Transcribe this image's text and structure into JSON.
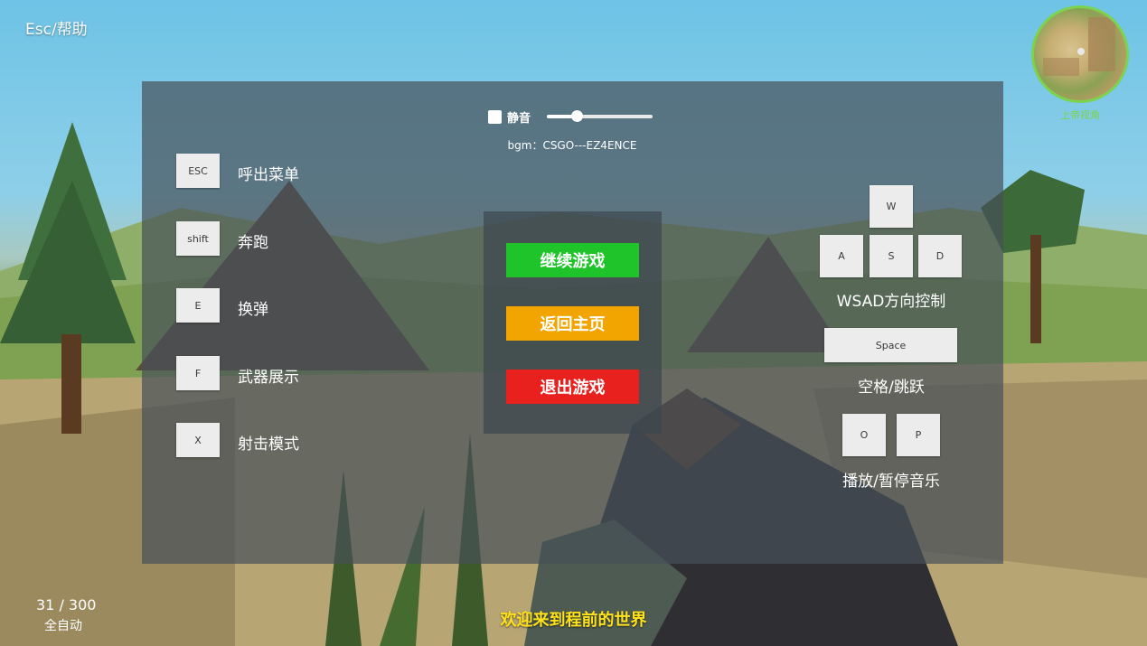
{
  "top_help": "Esc/帮助",
  "minimap": {
    "label": "上帝视角"
  },
  "audio": {
    "mute_label": "静音",
    "mute_checked": false,
    "volume": 0.28,
    "bgm_text": "bgm：CSGO---EZ4ENCE"
  },
  "left_keys": [
    {
      "key": "ESC",
      "label": "呼出菜单"
    },
    {
      "key": "shift",
      "label": "奔跑"
    },
    {
      "key": "E",
      "label": "换弹"
    },
    {
      "key": "F",
      "label": "武器展示"
    },
    {
      "key": "X",
      "label": "射击模式"
    }
  ],
  "menu": {
    "continue": {
      "label": "继续游戏",
      "color": "#1fc42a"
    },
    "home": {
      "label": "返回主页",
      "color": "#f2a500"
    },
    "exit": {
      "label": "退出游戏",
      "color": "#e8201e"
    }
  },
  "right_keys": {
    "move_keys": [
      "W",
      "A",
      "S",
      "D"
    ],
    "move_label": "WSAD方向控制",
    "jump_key": "Space",
    "jump_label": "空格/跳跃",
    "music_keys": [
      "O",
      "P"
    ],
    "music_label": "播放/暂停音乐"
  },
  "hud": {
    "ammo": "31 / 300",
    "fire_mode": "全自动"
  },
  "welcome": "欢迎来到程前的世界",
  "colors": {
    "panel": "#465058",
    "accent_green": "#7bd34f",
    "welcome_yellow": "#ffe21a"
  }
}
